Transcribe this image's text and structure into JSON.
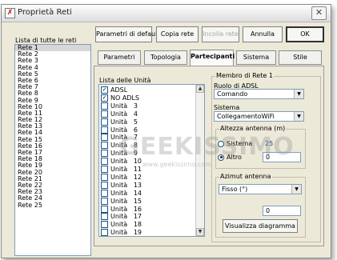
{
  "window": {
    "title": "Proprietà Reti",
    "close_glyph": "✕"
  },
  "left": {
    "list_label": "Lista di tutte le reti",
    "networks": [
      "Rete 1",
      "Rete 2",
      "Rete 3",
      "Rete 4",
      "Rete 5",
      "Rete 6",
      "Rete 7",
      "Rete 8",
      "Rete 9",
      "Rete 10",
      "Rete 11",
      "Rete 12",
      "Rete 13",
      "Rete 14",
      "Rete 15",
      "Rete 16",
      "Rete 17",
      "Rete 18",
      "Rete 19",
      "Rete 20",
      "Rete 21",
      "Rete 22",
      "Rete 23",
      "Rete 24",
      "Rete 25"
    ],
    "selected_index": 0
  },
  "toolbar": {
    "default_params": "Parametri di default",
    "copy": "Copia rete",
    "paste": "Incolla rete",
    "cancel": "Annulla",
    "ok": "OK"
  },
  "tabs": [
    "Parametri",
    "Topologia",
    "Partecipanti",
    "Sistema",
    "Stile"
  ],
  "active_tab": "Partecipanti",
  "units": {
    "label": "Lista delle Unità",
    "items": [
      {
        "name": "ADSL",
        "checked": true
      },
      {
        "name": "NO ADLS",
        "checked": true
      },
      {
        "name": "Unità   3",
        "checked": false
      },
      {
        "name": "Unità   4",
        "checked": false
      },
      {
        "name": "Unità   5",
        "checked": false
      },
      {
        "name": "Unità   6",
        "checked": false
      },
      {
        "name": "Unità   7",
        "checked": false
      },
      {
        "name": "Unità   8",
        "checked": false
      },
      {
        "name": "Unità   9",
        "checked": false
      },
      {
        "name": "Unità   10",
        "checked": false
      },
      {
        "name": "Unità   11",
        "checked": false
      },
      {
        "name": "Unità   12",
        "checked": false
      },
      {
        "name": "Unità   13",
        "checked": false
      },
      {
        "name": "Unità   14",
        "checked": false
      },
      {
        "name": "Unità   15",
        "checked": false
      },
      {
        "name": "Unità   16",
        "checked": false
      },
      {
        "name": "Unità   17",
        "checked": false
      },
      {
        "name": "Unità   18",
        "checked": false
      },
      {
        "name": "Unità   19",
        "checked": false
      }
    ]
  },
  "member": {
    "group_title": "Membro di Rete  1",
    "role_label": "Ruolo di ADSL",
    "role_value": "Comando",
    "system_label": "Sistema",
    "system_value": "CollegamentoWiFi"
  },
  "antenna_height": {
    "title": "Altezza antenna (m)",
    "option_system": "Sistema",
    "system_value": "25",
    "option_other": "Altro",
    "other_value": "0"
  },
  "azimuth": {
    "title": "Azimut antenna",
    "value": "Fisso (°)",
    "number": "0",
    "show_diagram": "Visualizza diagramma"
  },
  "watermark": {
    "text": "GEEKISSIMO",
    "url": "www.geekissimo.com"
  }
}
